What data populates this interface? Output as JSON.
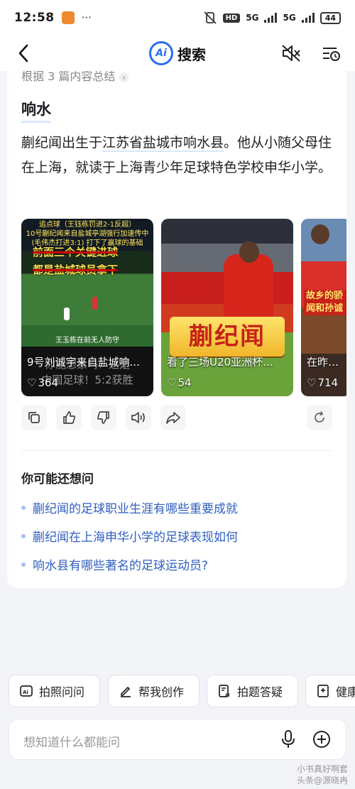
{
  "status": {
    "time": "12:58",
    "dots": "···",
    "hd": "HD",
    "net1": "5G",
    "net2": "5G",
    "battery": "44"
  },
  "nav": {
    "title": "搜索",
    "logo": "Ai"
  },
  "answer": {
    "summary": "根据 3 篇内容总结",
    "heading": "响水",
    "para_a": "蒯纪闻出生于",
    "para_link": "江苏省盐城市响水县",
    "para_b": "。他从小随父母住在上海，就读于上海青少年足球特色学校申华小学。"
  },
  "videos": [
    {
      "title": "9号刘诚宇来自盐城响...",
      "likes": "364",
      "overlay_lines": [
        "追点球（王钰栋罚进2-1反超）",
        "10号蒯纪闻来自盐城亭湖强行加速传中",
        "(毛伟杰打进3:1) 打下了赢球的基础"
      ],
      "overlay_big1": "前面三个关键进球",
      "overlay_big2": "都是盐城球员拿下",
      "overlay_small": "王玉栋在前无人防守",
      "overlay_bottom1": "你能想象吗？这是",
      "overlay_bottom2": "中国足球！5:2获胜"
    },
    {
      "title": "看了三场U20亚洲杯...",
      "likes": "54",
      "big_text": "蒯纪闻"
    },
    {
      "title": "在昨晚结",
      "likes": "714",
      "overlay_text": "故乡的骄 闻和孙诚"
    }
  ],
  "suggestions": {
    "heading": "你可能还想问",
    "items": [
      "蒯纪闻的足球职业生涯有哪些重要成就",
      "蒯纪闻在上海申华小学的足球表现如何",
      "响水县有哪些著名的足球运动员?"
    ]
  },
  "chips": [
    "拍照问问",
    "帮我创作",
    "拍题答疑",
    "健康"
  ],
  "input": {
    "placeholder": "想知道什么都能问"
  },
  "watermark": {
    "line1": "小书真好啊套",
    "line2": "头条@源晓冉"
  }
}
